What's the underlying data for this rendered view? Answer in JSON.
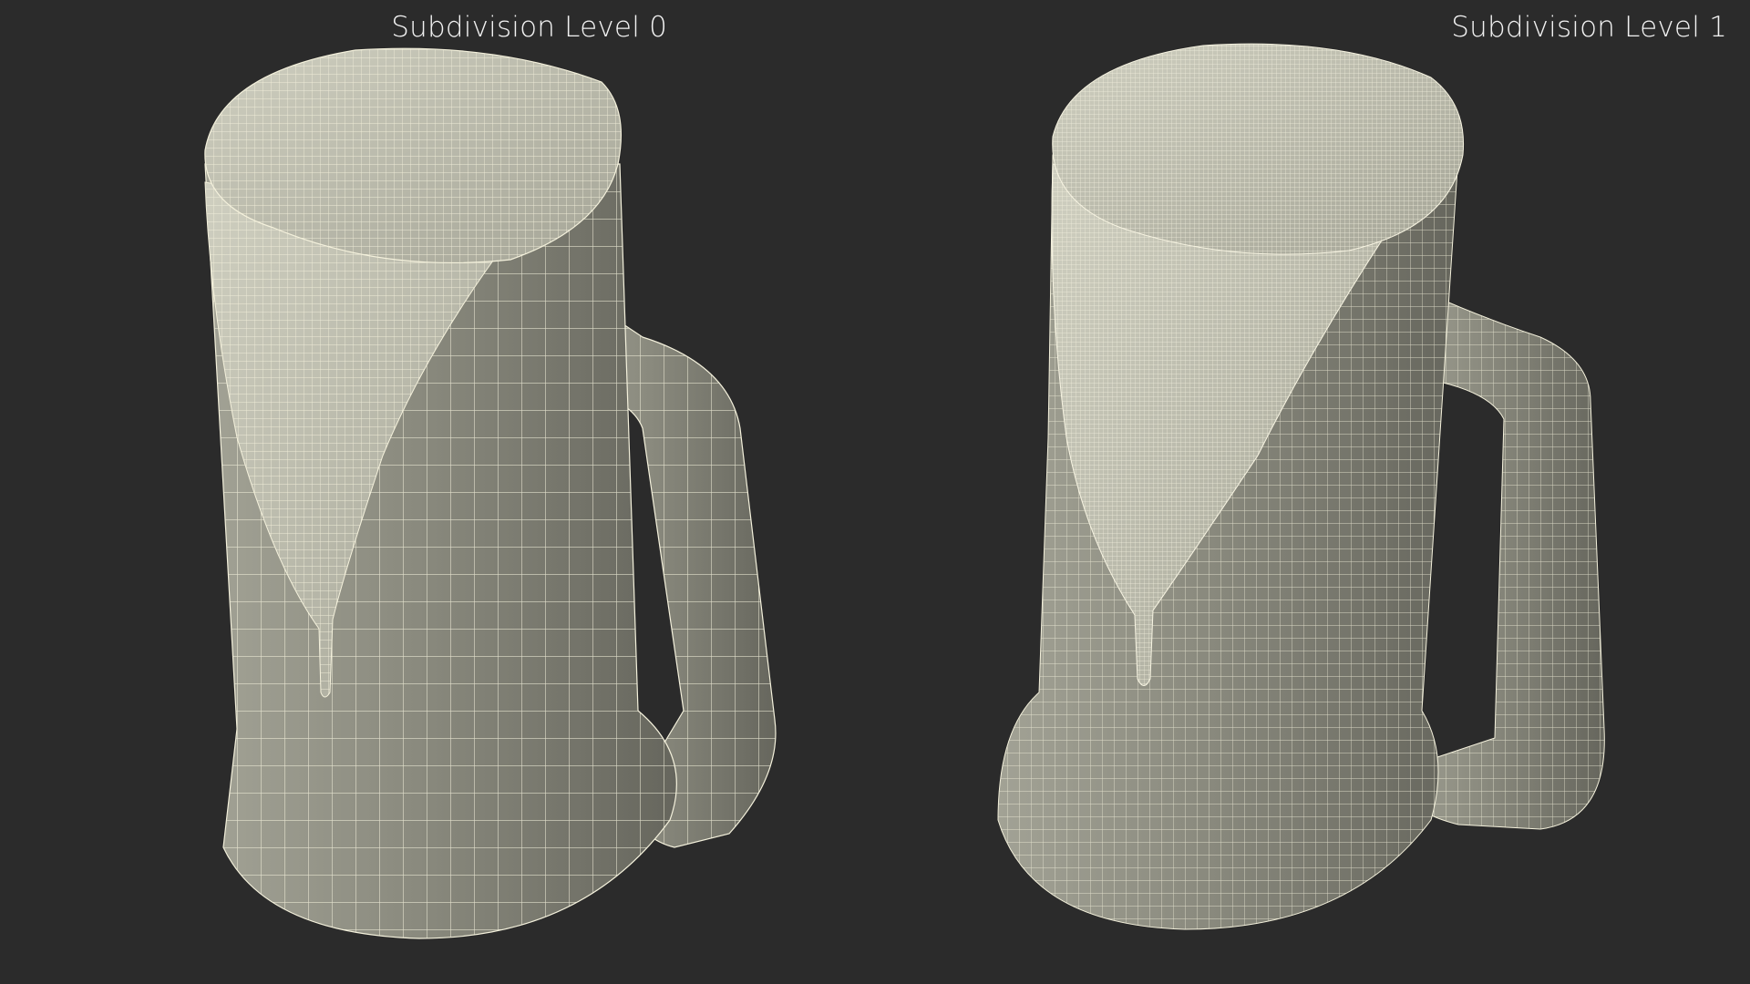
{
  "labels": {
    "left": "Subdivision Level 0",
    "right": "Subdivision Level 1"
  },
  "colors": {
    "background": "#2b2b2b",
    "mug_surface": "#8a8a7e",
    "mug_shadow": "#5f5f56",
    "foam_surface": "#b7b7a9",
    "wire": "#f4f1dc",
    "label_text": "#f2f2f2"
  },
  "models": [
    {
      "name": "beer-mug-with-foam",
      "subdivision_level": 0,
      "wire_density": "coarse"
    },
    {
      "name": "beer-mug-with-foam",
      "subdivision_level": 1,
      "wire_density": "fine"
    }
  ]
}
